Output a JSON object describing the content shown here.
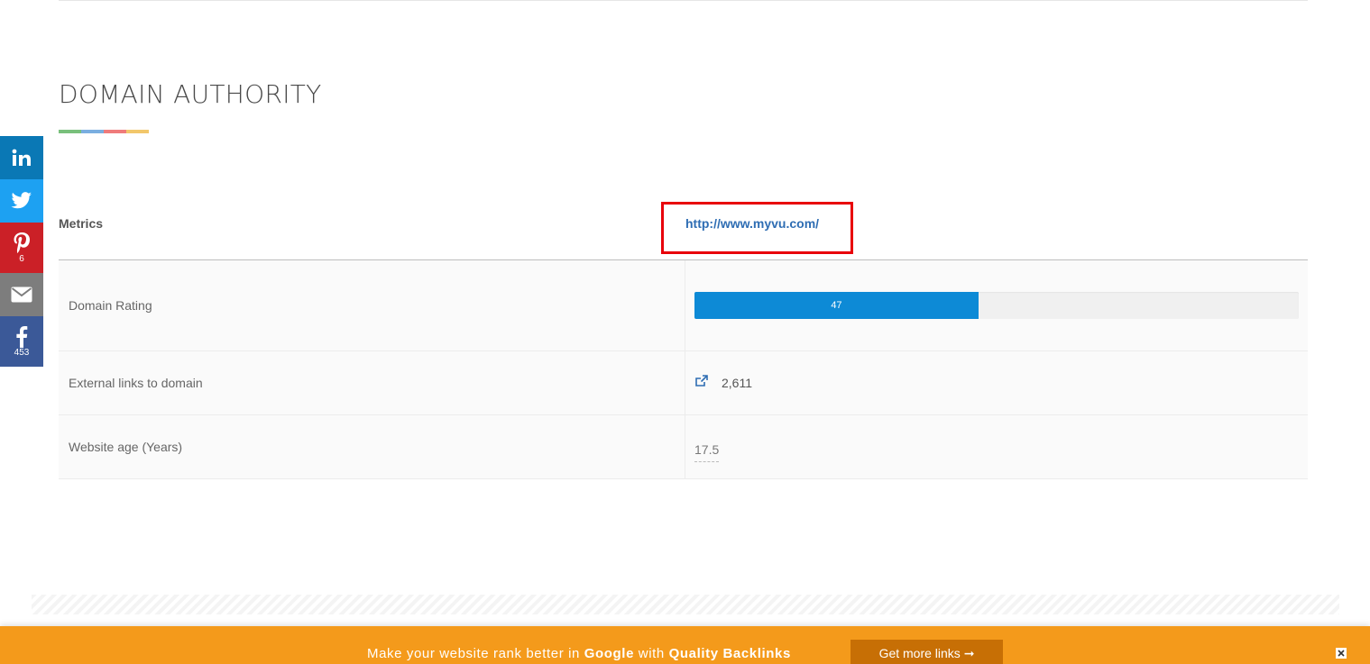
{
  "section": {
    "title": "DOMAIN AUTHORITY"
  },
  "title_underline_colors": [
    "#79c07c",
    "#7aaee0",
    "#ef7b7b",
    "#f2c76b"
  ],
  "share": {
    "linkedin": {
      "color": "#0a78b5",
      "icon": "linkedin-icon"
    },
    "twitter": {
      "color": "#1da1f2",
      "icon": "twitter-icon"
    },
    "pinterest": {
      "color": "#cb2027",
      "icon": "pinterest-icon",
      "count": "6"
    },
    "email": {
      "color": "#7d7d7d",
      "icon": "email-icon"
    },
    "facebook": {
      "color": "#3b5998",
      "icon": "facebook-icon",
      "count": "453"
    }
  },
  "metrics": {
    "header_label": "Metrics",
    "url": "http://www.myvu.com/",
    "rows": {
      "domain_rating": {
        "label": "Domain Rating",
        "value": "47",
        "percent": 47
      },
      "external_links": {
        "label": "External links to domain",
        "value": "2,611"
      },
      "website_age": {
        "label": "Website age (Years)",
        "value": "17.5"
      }
    }
  },
  "promo": {
    "text_before": "Make your website rank better in ",
    "brand": "Google",
    "text_middle": " with ",
    "highlight": "Quality Backlinks",
    "cta": "Get more links ➞",
    "bg_color": "#f49a1b",
    "cta_color": "#c76f05"
  }
}
